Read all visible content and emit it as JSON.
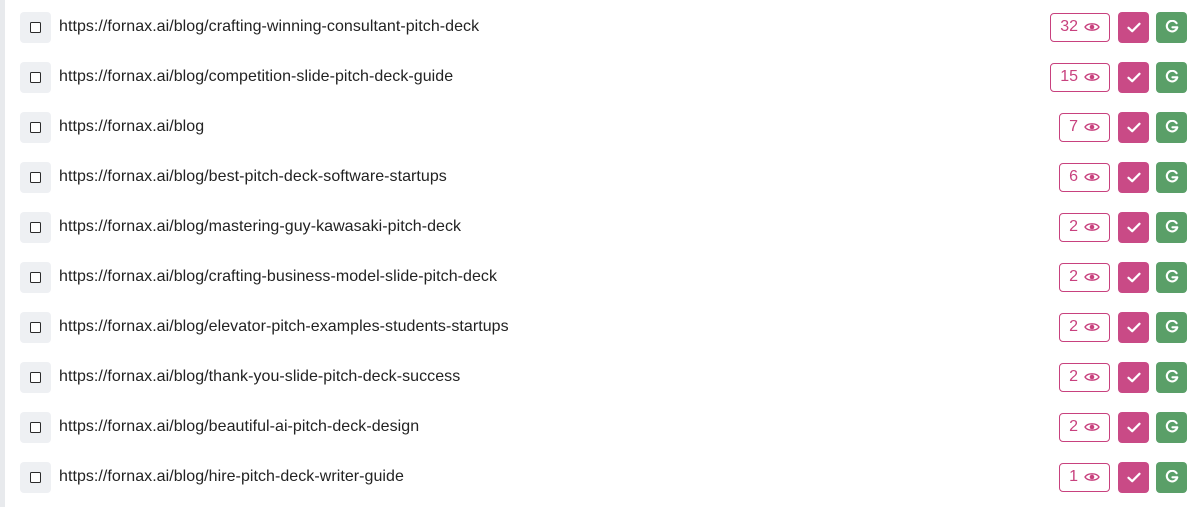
{
  "pages": [
    {
      "url": "https://fornax.ai/blog/crafting-winning-consultant-pitch-deck",
      "views": "32"
    },
    {
      "url": "https://fornax.ai/blog/competition-slide-pitch-deck-guide",
      "views": "15"
    },
    {
      "url": "https://fornax.ai/blog",
      "views": "7"
    },
    {
      "url": "https://fornax.ai/blog/best-pitch-deck-software-startups",
      "views": "6"
    },
    {
      "url": "https://fornax.ai/blog/mastering-guy-kawasaki-pitch-deck",
      "views": "2"
    },
    {
      "url": "https://fornax.ai/blog/crafting-business-model-slide-pitch-deck",
      "views": "2"
    },
    {
      "url": "https://fornax.ai/blog/elevator-pitch-examples-students-startups",
      "views": "2"
    },
    {
      "url": "https://fornax.ai/blog/thank-you-slide-pitch-deck-success",
      "views": "2"
    },
    {
      "url": "https://fornax.ai/blog/beautiful-ai-pitch-deck-design",
      "views": "2"
    },
    {
      "url": "https://fornax.ai/blog/hire-pitch-deck-writer-guide",
      "views": "1"
    }
  ],
  "icons": {
    "checkbox": "checkbox-icon",
    "views": "eye-icon",
    "mark": "checkmark-icon",
    "google": "google-g-icon"
  },
  "colors": {
    "accent_pink": "#c94a86",
    "accent_green": "#5a9f68",
    "text": "#222222"
  }
}
